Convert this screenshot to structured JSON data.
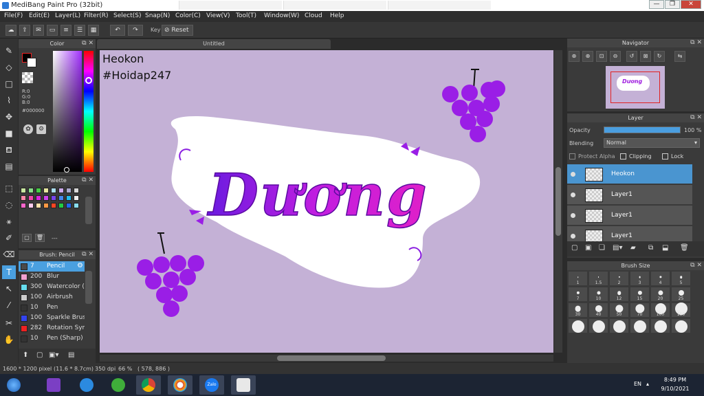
{
  "window": {
    "title": "MediBang Paint Pro (32bit)"
  },
  "titlebar": {
    "minimize": "—",
    "restore": "❐",
    "close": "✕"
  },
  "menu": [
    "File(F)",
    "Edit(E)",
    "Layer(L)",
    "Filter(R)",
    "Select(S)",
    "Snap(N)",
    "Color(C)",
    "View(V)",
    "Tool(T)",
    "Window(W)",
    "Cloud",
    "Help"
  ],
  "toolbar": {
    "key_label": "Key",
    "reset_label": "Reset"
  },
  "color_panel": {
    "title": "Color",
    "rgb": [
      "R:0",
      "G:0",
      "B:0"
    ],
    "hex": "#000000",
    "primary": "#000000",
    "secondary": "#ffffff"
  },
  "palette_panel": {
    "title": "Palette",
    "swatches": [
      "#c8e6a0",
      "#88dd88",
      "#44cc44",
      "#e8e8a0",
      "#aaddee",
      "#ccaaee",
      "#aaaacc",
      "#d8d8d8",
      "#ff88aa",
      "#ee44aa",
      "#dd22dd",
      "#cc44ee",
      "#7744ee",
      "#4488ee",
      "#22bbee",
      "#eeeeee",
      "#ff66cc",
      "#ffccee",
      "#ffe0aa",
      "#ff9944",
      "#ff4422",
      "#22cc44",
      "#2266ee",
      "#88ddee"
    ],
    "dash": "---"
  },
  "brush_panel": {
    "title": "Brush: Pencil",
    "items": [
      {
        "size": "7",
        "name": "Pencil",
        "color": "#4a4a4a",
        "active": true
      },
      {
        "size": "200",
        "name": "Blur",
        "color": "#f0a0d0"
      },
      {
        "size": "300",
        "name": "Watercolor (W",
        "color": "#66ddee"
      },
      {
        "size": "100",
        "name": "Airbrush",
        "color": "#cccccc"
      },
      {
        "size": "10",
        "name": "Pen",
        "color": "#333333"
      },
      {
        "size": "100",
        "name": "Sparkle Brush",
        "color": "#3344ee"
      },
      {
        "size": "282",
        "name": "Rotation Sym",
        "color": "#ee2222"
      },
      {
        "size": "10",
        "name": "Pen (Sharp)",
        "color": "#333333"
      }
    ]
  },
  "document": {
    "tab": "Untitled",
    "watermark_line1": "Heokon",
    "watermark_line2": "#Hoidap247",
    "lettering": "Dương",
    "background": "#c4b1d6",
    "accent": "#9a1ee6"
  },
  "navigator_panel": {
    "title": "Navigator"
  },
  "layer_panel": {
    "title": "Layer",
    "opacity_label": "Opacity",
    "opacity_value": "100 %",
    "blending_label": "Blending",
    "blending_value": "Normal",
    "protect_alpha": "Protect Alpha",
    "clipping": "Clipping",
    "lock": "Lock",
    "layers": [
      {
        "name": "Heokon",
        "active": true
      },
      {
        "name": "Layer1"
      },
      {
        "name": "Layer1"
      },
      {
        "name": "Layer1"
      }
    ]
  },
  "brush_size_panel": {
    "title": "Brush Size",
    "sizes": [
      "1",
      "1.5",
      "2",
      "3",
      "4",
      "5",
      "7",
      "10",
      "12",
      "15",
      "20",
      "25",
      "30",
      "40",
      "50",
      "70",
      "100",
      "150"
    ]
  },
  "status": {
    "pixels": "1600 * 1200 pixel",
    "physical": "(11.6 * 8.7cm)",
    "dpi": "350 dpi",
    "zoom": "66 %",
    "cursor": "( 578, 886 )"
  },
  "taskbar": {
    "lang": "EN",
    "time": "8:49 PM",
    "date": "9/10/2021",
    "zalo": "Zalo"
  }
}
